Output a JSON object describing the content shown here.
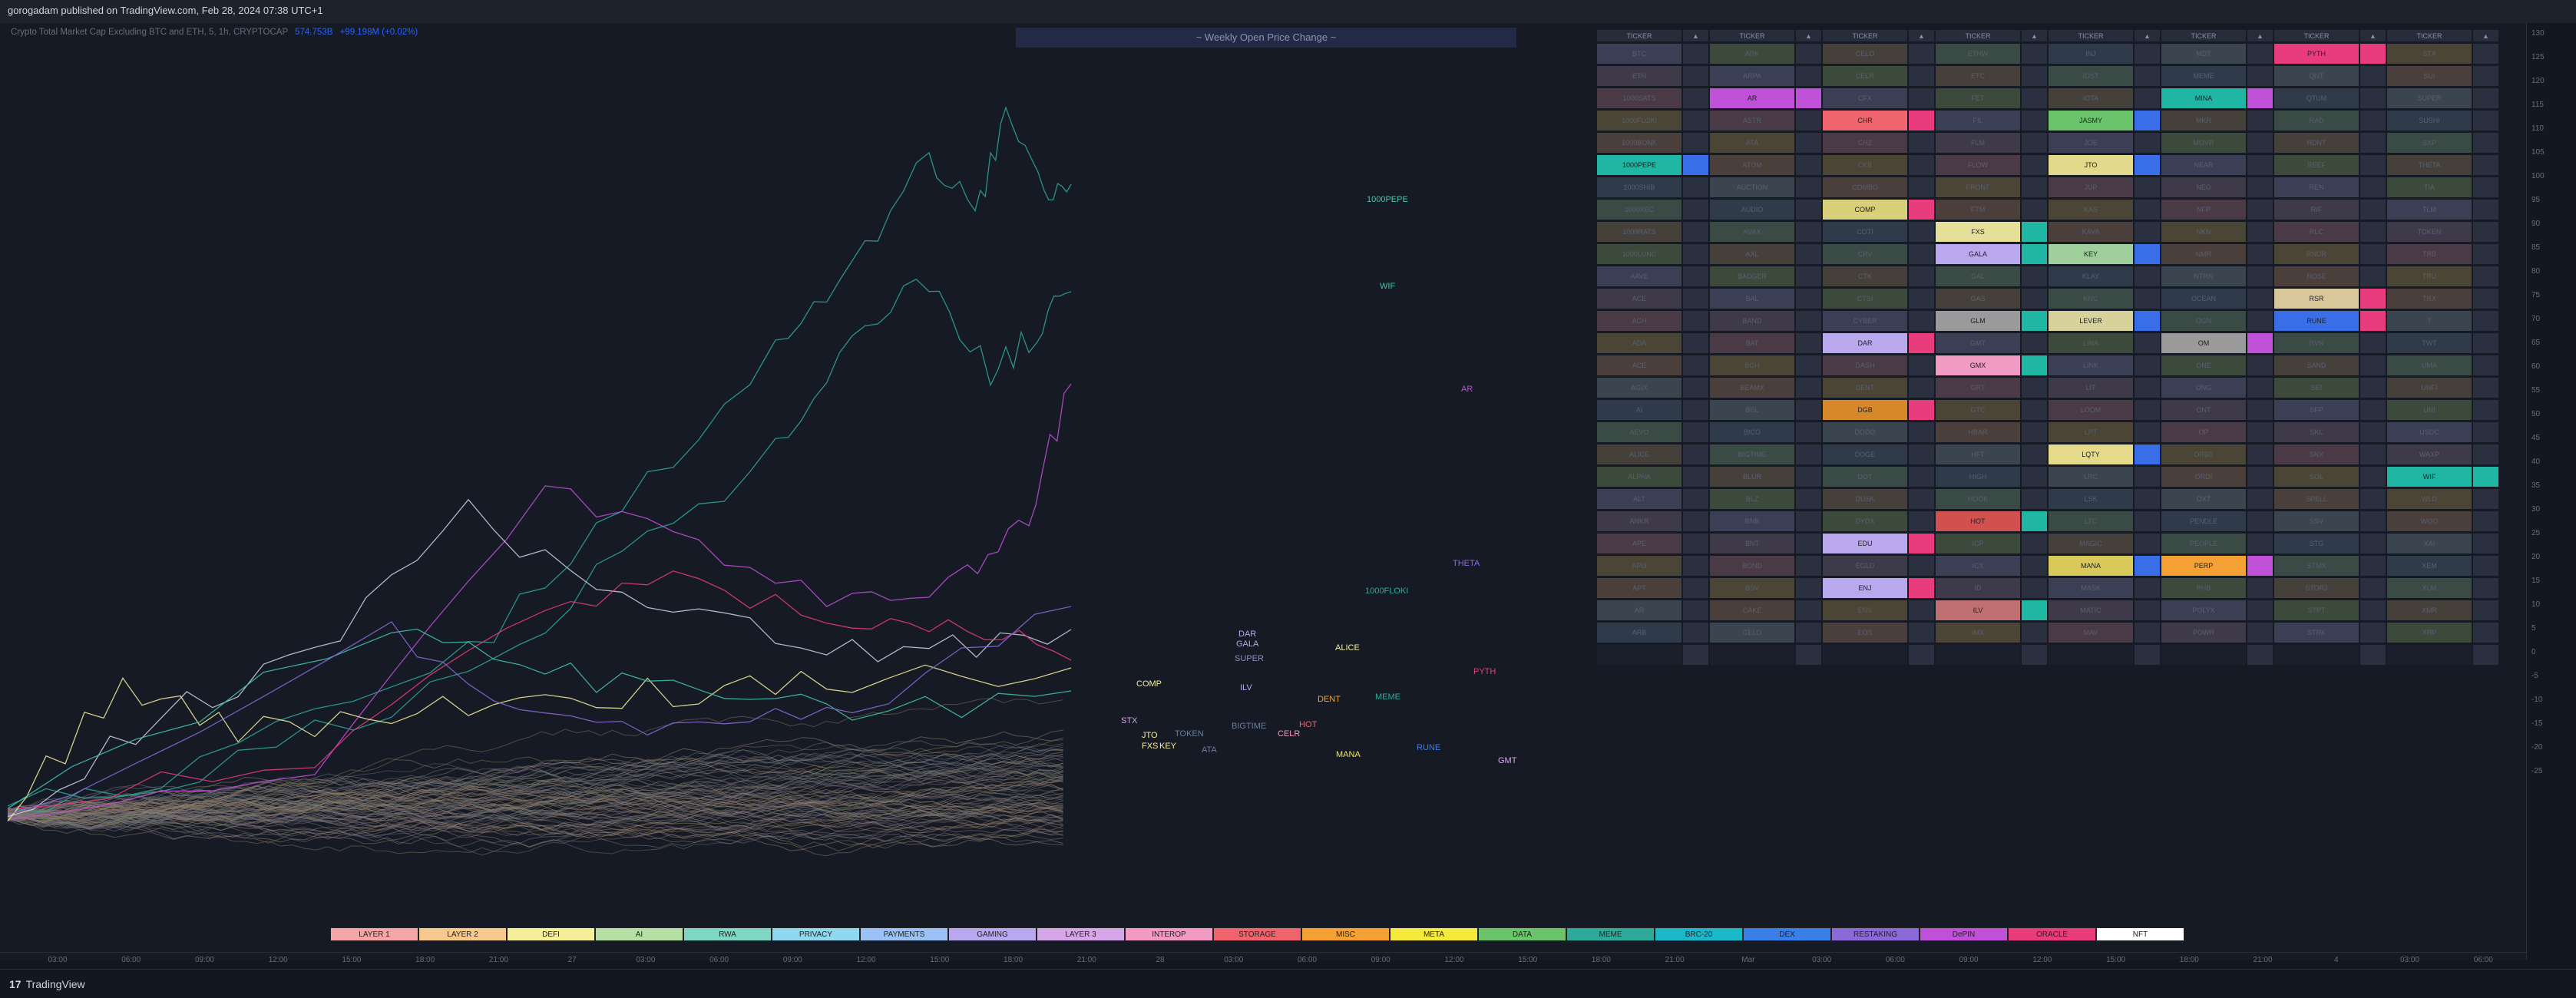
{
  "header": {
    "published": "gorogadam published on TradingView.com, Feb 28, 2024 07:38 UTC+1"
  },
  "symbol": {
    "name": "Crypto Total Market Cap Excluding BTC and ETH, 5, 1h, CRYPTOCAP",
    "price": "574.753B",
    "change": "+99.198M (+0.02%)"
  },
  "banner": {
    "title": "~ Weekly Open Price Change ~"
  },
  "table": {
    "header_ticker": "TICKER",
    "header_flag": "▲",
    "columns": [
      [
        "BTC",
        "ETH",
        "1000SATS",
        "1000FLOKI",
        "1000BONK",
        "1000PEPE",
        "1000SHIB",
        "1000XEC",
        "1000RATS",
        "1000LUNC",
        "AAVE",
        "ACE",
        "ACH",
        "ADA",
        "ACE",
        "AGIX",
        "AI",
        "AEVO",
        "ALICE",
        "ALPHA",
        "ALT",
        "ANKR",
        "APE",
        "API3",
        "APT",
        "AR",
        "ARB",
        ""
      ],
      [
        "ARK",
        "ARPA",
        "AR",
        "ASTR",
        "ATA",
        "ATOM",
        "AUCTION",
        "AUDIO",
        "AVAX",
        "AXL",
        "BADGER",
        "BAL",
        "BAND",
        "BAT",
        "BCH",
        "BEAMX",
        "BEL",
        "BICO",
        "BIGTIME",
        "BLUR",
        "BLZ",
        "BNB",
        "BNT",
        "BOND",
        "BSV",
        "CAKE",
        "CELO",
        ""
      ],
      [
        "CELO",
        "CELR",
        "CFX",
        "CHR",
        "CHZ",
        "CKB",
        "COMBO",
        "COMP",
        "COTI",
        "CRV",
        "CTK",
        "CTSI",
        "CYBER",
        "DAR",
        "DASH",
        "DENT",
        "DGB",
        "DODO",
        "DOGE",
        "DOT",
        "DUSK",
        "DYDX",
        "EDU",
        "EGLD",
        "ENJ",
        "ENS",
        "EOS",
        ""
      ],
      [
        "ETHW",
        "ETC",
        "FET",
        "FIL",
        "FLM",
        "FLOW",
        "FRONT",
        "FTM",
        "FXS",
        "GALA",
        "GAL",
        "GAS",
        "GLM",
        "GMT",
        "GMX",
        "GRT",
        "GTC",
        "HBAR",
        "HFT",
        "HIGH",
        "HOOK",
        "HOT",
        "ICP",
        "ICX",
        "ID",
        "ILV",
        "IMX",
        ""
      ],
      [
        "INJ",
        "IOST",
        "IOTA",
        "JASMY",
        "JOE",
        "JTO",
        "JUP",
        "KAS",
        "KAVA",
        "KEY",
        "KLAY",
        "KNC",
        "LEVER",
        "LINA",
        "LINK",
        "LIT",
        "LOOM",
        "LPT",
        "LQTY",
        "LRC",
        "LSK",
        "LTC",
        "MAGIC",
        "MANA",
        "MASK",
        "MATIC",
        "MAV",
        ""
      ],
      [
        "MDT",
        "MEME",
        "MINA",
        "MKR",
        "MOVR",
        "NEAR",
        "NEO",
        "NFP",
        "NKN",
        "NMR",
        "NTRN",
        "OCEAN",
        "OGN",
        "OM",
        "ONE",
        "ONG",
        "ONT",
        "OP",
        "ORBS",
        "ORDI",
        "OXT",
        "PENDLE",
        "PEOPLE",
        "PERP",
        "PHB",
        "POLYX",
        "POWR",
        ""
      ],
      [
        "PYTH",
        "QNT",
        "QTUM",
        "RAD",
        "RDNT",
        "REEF",
        "REN",
        "RIF",
        "RLC",
        "RNDR",
        "ROSE",
        "RSR",
        "RUNE",
        "RVN",
        "SAND",
        "SEI",
        "SFP",
        "SKL",
        "SNX",
        "SOL",
        "SPELL",
        "SSV",
        "STG",
        "STMX",
        "STORJ",
        "STPT",
        "STRK",
        ""
      ],
      [
        "STX",
        "SUI",
        "SUPER",
        "SUSHI",
        "SXP",
        "THETA",
        "TIA",
        "TLM",
        "TOKEN",
        "TRB",
        "TRU",
        "TRX",
        "T",
        "TWT",
        "UMA",
        "UNFI",
        "UNI",
        "USDC",
        "WAXP",
        "WIF",
        "WLD",
        "WOO",
        "XAI",
        "XEM",
        "XLM",
        "XMR",
        "XRP",
        ""
      ]
    ]
  },
  "yaxis": {
    "ticks": [
      "130",
      "125",
      "120",
      "115",
      "110",
      "105",
      "100",
      "95",
      "90",
      "85",
      "80",
      "75",
      "70",
      "65",
      "60",
      "55",
      "50",
      "45",
      "40",
      "35",
      "30",
      "25",
      "20",
      "15",
      "10",
      "5",
      "0",
      "-5",
      "-10",
      "-15",
      "-20",
      "-25"
    ]
  },
  "xaxis": {
    "ticks": [
      "03:00",
      "06:00",
      "09:00",
      "12:00",
      "15:00",
      "18:00",
      "21:00",
      "27",
      "03:00",
      "06:00",
      "09:00",
      "12:00",
      "15:00",
      "18:00",
      "21:00",
      "28",
      "03:00",
      "06:00",
      "09:00",
      "12:00",
      "15:00",
      "18:00",
      "21:00",
      "Mar",
      "03:00",
      "06:00",
      "09:00",
      "12:00",
      "15:00",
      "18:00",
      "21:00",
      "4",
      "03:00",
      "06:00"
    ]
  },
  "legend": [
    {
      "label": "LAYER 1",
      "color": "#f4a6a6"
    },
    {
      "label": "LAYER 2",
      "color": "#f7c98f"
    },
    {
      "label": "DEFI",
      "color": "#f5ef9a"
    },
    {
      "label": "AI",
      "color": "#b6e0a4"
    },
    {
      "label": "RWA",
      "color": "#7fd6c2"
    },
    {
      "label": "PRIVACY",
      "color": "#8fd8ee"
    },
    {
      "label": "PAYMENTS",
      "color": "#9cc2f5"
    },
    {
      "label": "GAMING",
      "color": "#b9a8ee"
    },
    {
      "label": "LAYER 3",
      "color": "#d7a6e8"
    },
    {
      "label": "INTEROP",
      "color": "#f19bc4"
    },
    {
      "label": "STORAGE",
      "color": "#f0656d"
    },
    {
      "label": "MISC",
      "color": "#f5a035"
    },
    {
      "label": "META",
      "color": "#f5ea3c"
    },
    {
      "label": "DATA",
      "color": "#6bc46c"
    },
    {
      "label": "MEME",
      "color": "#2ea99a"
    },
    {
      "label": "BRC-20",
      "color": "#1ab8c9"
    },
    {
      "label": "DEX",
      "color": "#3a7ee8"
    },
    {
      "label": "RESTAKING",
      "color": "#8b6ad8"
    },
    {
      "label": "DePIN",
      "color": "#c050d8"
    },
    {
      "label": "ORACLE",
      "color": "#e93c7c"
    },
    {
      "label": "NFT",
      "color": "#ffffff"
    }
  ],
  "chart_labels": [
    {
      "text": "1000PEPE",
      "color": "#3fc7ad"
    },
    {
      "text": "WIF",
      "color": "#3fc7ad"
    },
    {
      "text": "AR",
      "color": "#c050d8"
    },
    {
      "text": "THETA",
      "color": "#8b6ad8"
    },
    {
      "text": "1000FLOKI",
      "color": "#2ea99a"
    },
    {
      "text": "PYTH",
      "color": "#e93c7c"
    },
    {
      "text": "DAR",
      "color": "#b9a8ee"
    },
    {
      "text": "GALA",
      "color": "#b9a8ee"
    },
    {
      "text": "SUPER",
      "color": "#8b8fb8"
    },
    {
      "text": "ALICE",
      "color": "#f5ef9a"
    },
    {
      "text": "COMP",
      "color": "#f5ef9a"
    },
    {
      "text": "ILV",
      "color": "#b9a8ee"
    },
    {
      "text": "DENT",
      "color": "#f5a035"
    },
    {
      "text": "MEME",
      "color": "#2ea99a"
    },
    {
      "text": "JTO",
      "color": "#f5ef9a"
    },
    {
      "text": "KEY",
      "color": "#f5ef9a"
    },
    {
      "text": "CELR",
      "color": "#f19bc4"
    },
    {
      "text": "HOT",
      "color": "#f0656d"
    },
    {
      "text": "MANA",
      "color": "#f5ea3c"
    },
    {
      "text": "FXS",
      "color": "#f5ef9a"
    },
    {
      "text": "STX",
      "color": "#d7a6e8"
    },
    {
      "text": "RUNE",
      "color": "#3a7ee8"
    },
    {
      "text": "GMT",
      "color": "#d7a6e8"
    },
    {
      "text": "TOKEN",
      "color": "#6a7e9b"
    },
    {
      "text": "ATA",
      "color": "#6a7e9b"
    },
    {
      "text": "BIGTIME",
      "color": "#6a7e9b"
    }
  ],
  "footer": {
    "brand": "TradingView",
    "mark": "17"
  }
}
